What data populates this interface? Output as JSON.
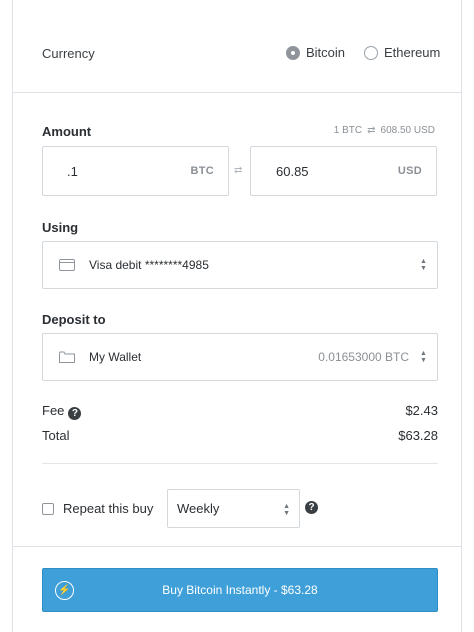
{
  "currency": {
    "label": "Currency",
    "options": [
      {
        "label": "Bitcoin",
        "selected": true
      },
      {
        "label": "Ethereum",
        "selected": false
      }
    ]
  },
  "amount": {
    "label": "Amount",
    "rate_left": "1 BTC",
    "rate_right": "608.50 USD",
    "btc_value": ".1",
    "btc_unit": "BTC",
    "usd_value": "60.85",
    "usd_unit": "USD"
  },
  "using": {
    "label": "Using",
    "selected": "Visa debit ********4985"
  },
  "deposit": {
    "label": "Deposit to",
    "selected": "My Wallet",
    "balance": "0.01653000 BTC"
  },
  "fee": {
    "label": "Fee",
    "value": "$2.43"
  },
  "total": {
    "label": "Total",
    "value": "$63.28"
  },
  "repeat": {
    "label": "Repeat this buy",
    "checked": false,
    "frequency": "Weekly"
  },
  "buy_button": {
    "label": "Buy Bitcoin Instantly - $63.28"
  },
  "colors": {
    "accent": "#3f9fd8"
  }
}
